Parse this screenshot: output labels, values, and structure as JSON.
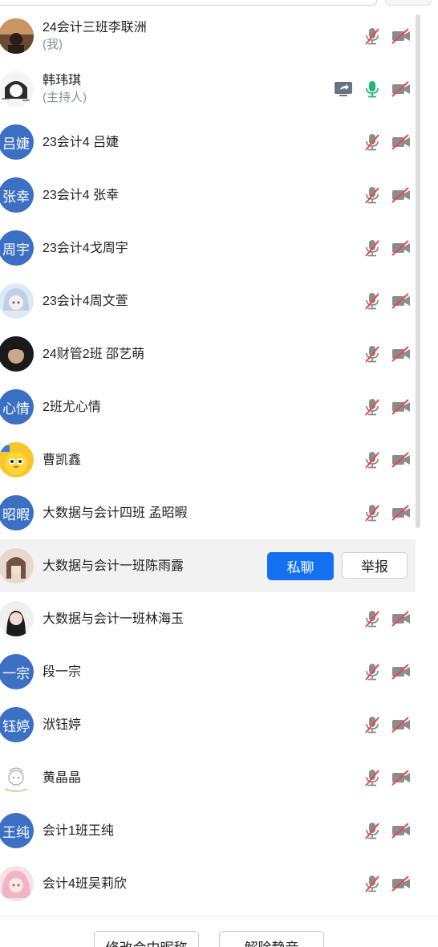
{
  "participants": [
    {
      "name": "24会计三班李联洲",
      "sub": "(我)",
      "avatar": {
        "type": "photo",
        "style": "dusk"
      },
      "status": [
        "mic-muted",
        "camera-off"
      ]
    },
    {
      "name": "韩玮琪",
      "sub": "(主持人)",
      "avatar": {
        "type": "photo",
        "style": "sketch"
      },
      "status": [
        "screen-share",
        "mic-on",
        "camera-off"
      ]
    },
    {
      "name": "23会计4 吕婕",
      "avatar": {
        "type": "text",
        "text": "吕婕"
      },
      "status": [
        "mic-muted",
        "camera-off"
      ]
    },
    {
      "name": "23会计4 张幸",
      "avatar": {
        "type": "text",
        "text": "张幸"
      },
      "status": [
        "mic-muted",
        "camera-off"
      ]
    },
    {
      "name": "23会计4戈周宇",
      "avatar": {
        "type": "text",
        "text": "周宇"
      },
      "status": [
        "mic-muted",
        "camera-off"
      ]
    },
    {
      "name": "23会计4周文萱",
      "avatar": {
        "type": "photo",
        "style": "anime-blue"
      },
      "status": [
        "mic-muted",
        "camera-off"
      ]
    },
    {
      "name": "24财管2班 邵艺萌",
      "avatar": {
        "type": "photo",
        "style": "dark"
      },
      "status": [
        "mic-muted",
        "camera-off"
      ]
    },
    {
      "name": "2班尤心情",
      "avatar": {
        "type": "text",
        "text": "心情"
      },
      "status": [
        "mic-muted",
        "camera-off"
      ]
    },
    {
      "name": "曹凯鑫",
      "avatar": {
        "type": "photo",
        "style": "yellow-bird"
      },
      "status": [
        "mic-muted",
        "camera-off"
      ]
    },
    {
      "name": "大数据与会计四班 孟昭暇",
      "avatar": {
        "type": "text",
        "text": "昭暇"
      },
      "status": [
        "mic-muted",
        "camera-off"
      ]
    },
    {
      "name": "大数据与会计一班陈雨露",
      "avatar": {
        "type": "photo",
        "style": "beige"
      },
      "hovered": true,
      "actions": {
        "chat": "私聊",
        "report": "举报"
      }
    },
    {
      "name": "大数据与会计一班林海玉",
      "avatar": {
        "type": "photo",
        "style": "girl-light"
      },
      "status": [
        "mic-muted",
        "camera-off"
      ]
    },
    {
      "name": "段一宗",
      "avatar": {
        "type": "text",
        "text": "一宗"
      },
      "status": [
        "mic-muted",
        "camera-off"
      ]
    },
    {
      "name": "洑钰婷",
      "avatar": {
        "type": "text",
        "text": "钰婷"
      },
      "status": [
        "mic-muted",
        "camera-off"
      ]
    },
    {
      "name": "黄晶晶",
      "avatar": {
        "type": "photo",
        "style": "doodle"
      },
      "status": [
        "mic-muted",
        "camera-off"
      ]
    },
    {
      "name": "会计1班王纯",
      "avatar": {
        "type": "text",
        "text": "王纯"
      },
      "status": [
        "mic-muted",
        "camera-off"
      ]
    },
    {
      "name": "会计4班吴莉欣",
      "avatar": {
        "type": "photo",
        "style": "anime-pink"
      },
      "status": [
        "mic-muted",
        "camera-off"
      ]
    }
  ],
  "footer": {
    "rename_label": "修改会中昵称",
    "unmute_label": "解除静音"
  },
  "colors": {
    "accent": "#1570ef",
    "avatar_bg": "#3d6fc2",
    "muted_red": "#e5484d",
    "mic_on": "#22b573",
    "icon_gray": "#6b7280"
  }
}
